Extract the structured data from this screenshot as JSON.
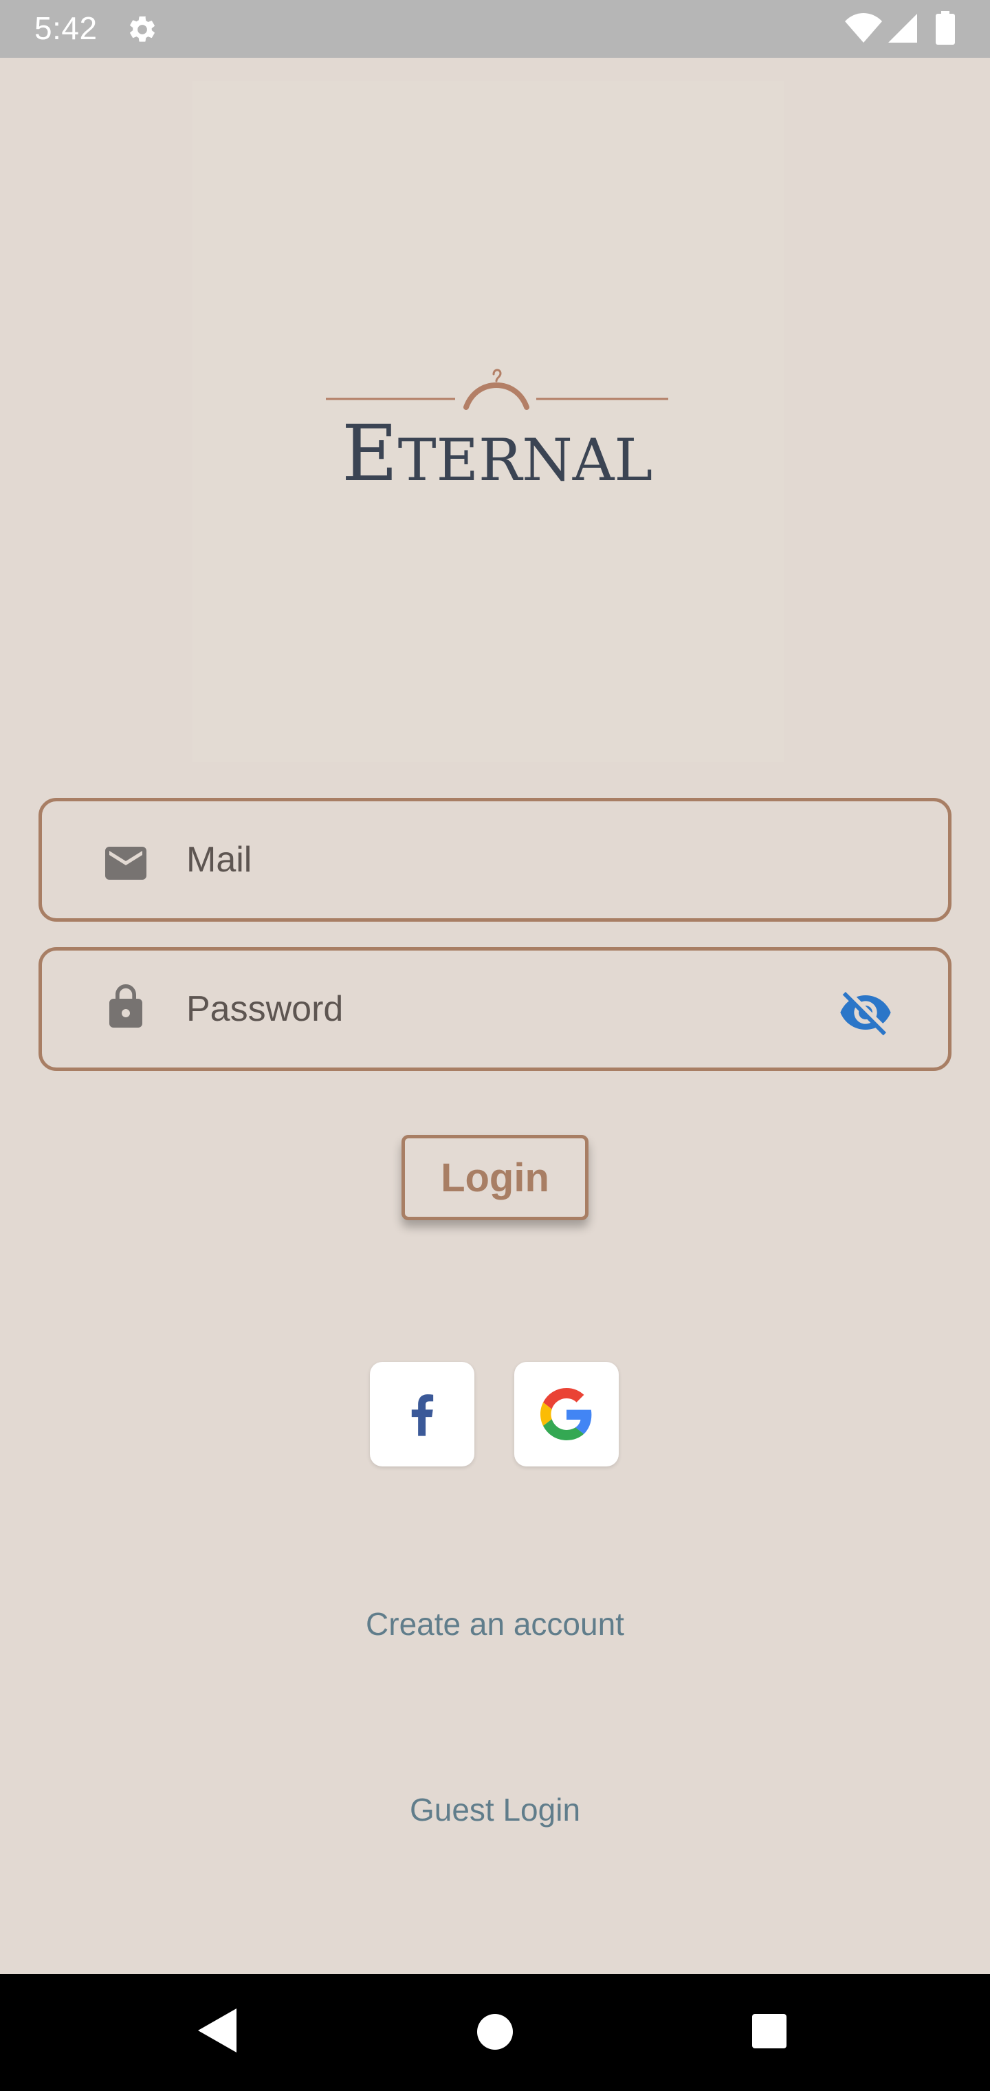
{
  "status_bar": {
    "time": "5:42",
    "icons": [
      "gear-icon",
      "wifi-icon",
      "signal-icon",
      "battery-icon"
    ]
  },
  "logo": {
    "brand_text": "ETERNAL",
    "colors": {
      "text": "#3b4453",
      "accent": "#b37f66"
    }
  },
  "form": {
    "mail_placeholder": "Mail",
    "password_placeholder": "Password",
    "login_label": "Login",
    "colors": {
      "border": "#a87e64",
      "icon": "#777371",
      "eye": "#2b76c8"
    }
  },
  "social": {
    "buttons": [
      "facebook-icon",
      "google-icon"
    ],
    "colors": {
      "facebook": "#3b5998"
    }
  },
  "links": {
    "create_account": "Create an account",
    "guest_login": "Guest Login"
  },
  "nav_bar": {
    "icons": [
      "back-icon",
      "home-icon",
      "recents-icon"
    ]
  }
}
